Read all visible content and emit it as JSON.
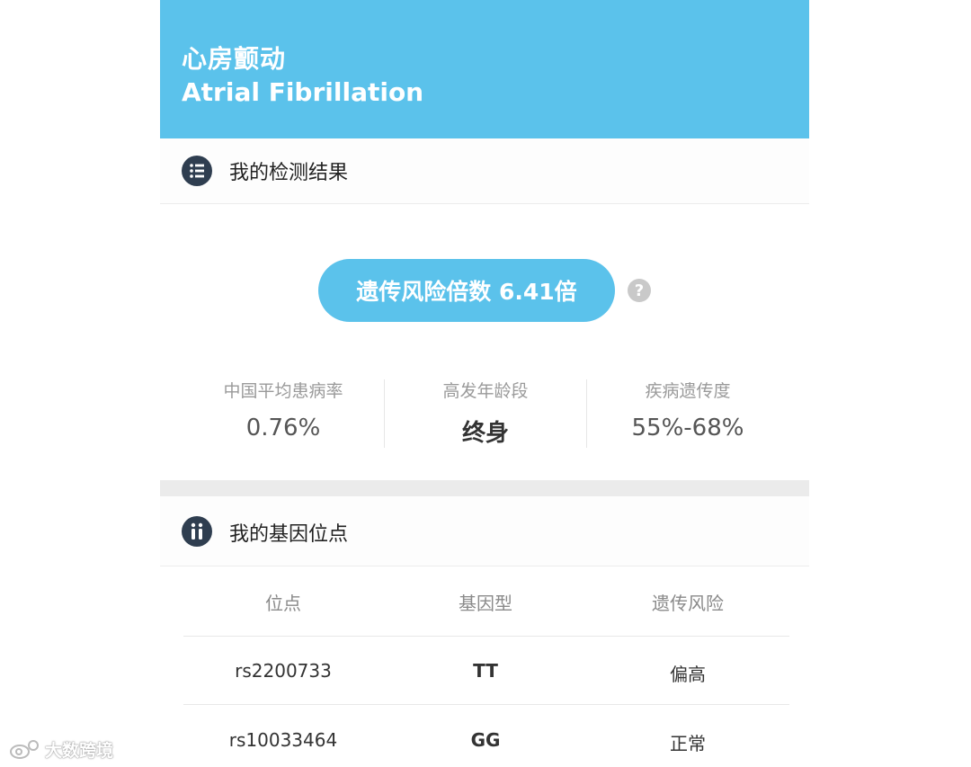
{
  "header": {
    "title_cn": "心房颤动",
    "title_en": "Atrial Fibrillation"
  },
  "result_section": {
    "title": "我的检测结果",
    "risk_label": "遗传风险倍数 6.41倍",
    "help_icon": "?",
    "stats": [
      {
        "label": "中国平均患病率",
        "value": "0.76%"
      },
      {
        "label": "高发年龄段",
        "value": "终身"
      },
      {
        "label": "疾病遗传度",
        "value": "55%-68%"
      }
    ]
  },
  "gene_section": {
    "title": "我的基因位点",
    "columns": [
      "位点",
      "基因型",
      "遗传风险"
    ],
    "rows": [
      {
        "locus": "rs2200733",
        "genotype": "TT",
        "risk": "偏高"
      },
      {
        "locus": "rs10033464",
        "genotype": "GG",
        "risk": "正常"
      }
    ]
  },
  "watermark": {
    "text": "大数跨境"
  },
  "colors": {
    "accent": "#5bc2eb",
    "icon_bg": "#2f3e50"
  },
  "icons": {
    "result_section": "list-icon",
    "gene_section": "gene-locus-icon",
    "help": "question-circle-icon"
  }
}
